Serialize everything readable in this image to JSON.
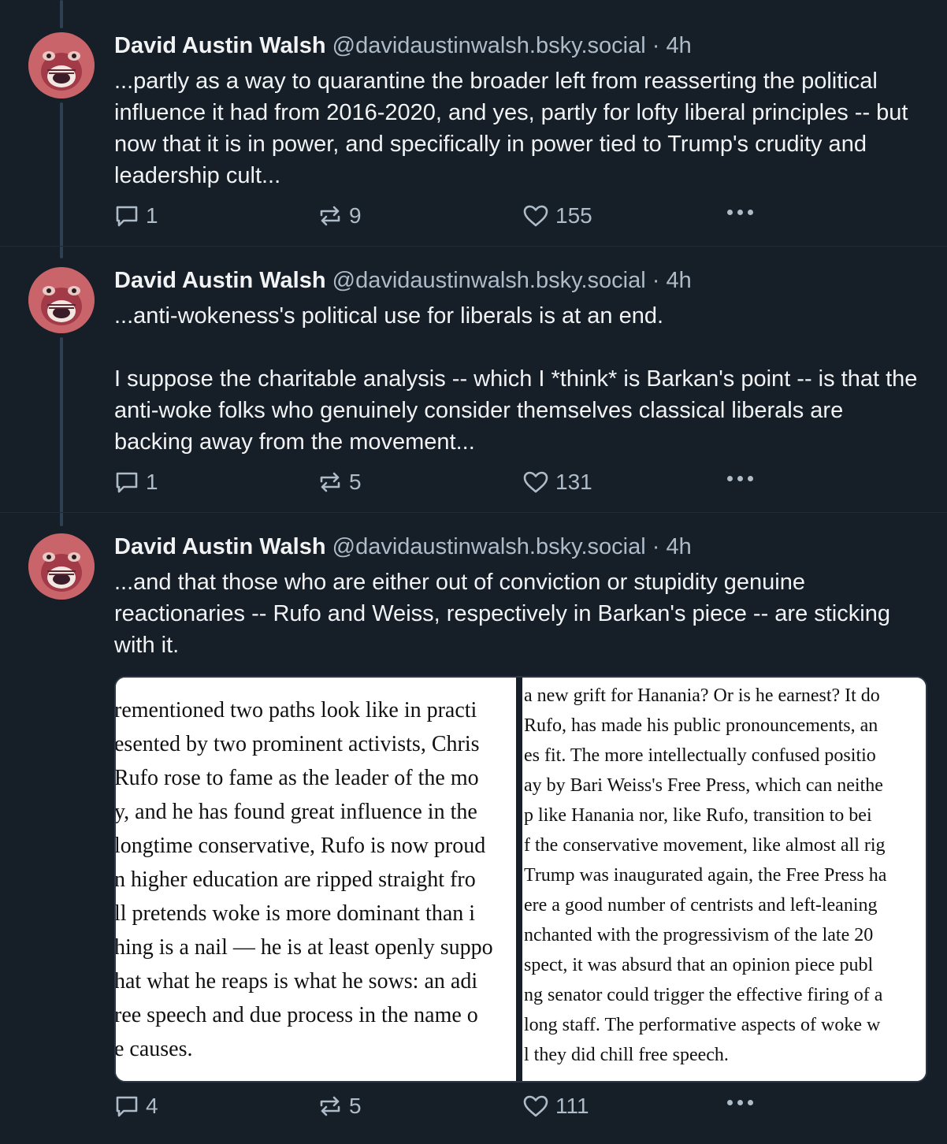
{
  "posts": [
    {
      "author": "David Austin Walsh",
      "handle": "@davidaustinwalsh.bsky.social",
      "separator": "·",
      "time": "4h",
      "text": "...partly as a way to quarantine the broader left from reasserting the political influence it had from 2016-2020, and yes, partly for lofty liberal principles -- but now that it is in power, and specifically in power tied to Trump's crudity and leadership cult...",
      "replies": "1",
      "reposts": "9",
      "likes": "155"
    },
    {
      "author": "David Austin Walsh",
      "handle": "@davidaustinwalsh.bsky.social",
      "separator": "·",
      "time": "4h",
      "text": "...anti-wokeness's political use for liberals is at an end.\n\nI suppose the charitable analysis -- which I *think* is Barkan's point -- is that the anti-woke folks who genuinely consider themselves classical liberals are backing away from the movement...",
      "replies": "1",
      "reposts": "5",
      "likes": "131"
    },
    {
      "author": "David Austin Walsh",
      "handle": "@davidaustinwalsh.bsky.social",
      "separator": "·",
      "time": "4h",
      "text": "...and that those who are either out of conviction or stupidity genuine reactionaries -- Rufo and Weiss, respectively in Barkan's piece -- are sticking with it.",
      "replies": "4",
      "reposts": "5",
      "likes": "111"
    }
  ],
  "images": {
    "left_lines": [
      "rementioned two paths look like in practi",
      "esented by two prominent activists, Chris",
      " Rufo rose to fame as the leader of the mo",
      "y, and he has found great influence in the",
      " longtime conservative, Rufo is now proud",
      "n higher education are ripped straight fro",
      "ll pretends woke is more dominant than i",
      "hing is a nail — he is at least openly suppo",
      "hat what he reaps is what he sows: an adi",
      "ree speech and due process in the name o",
      "e causes."
    ],
    "right_lines": [
      "a new grift for Hanania? Or is he earnest? It do",
      "Rufo, has made his public pronouncements, an",
      "es fit. The more intellectually confused positio",
      "ay by Bari Weiss's Free Press, which can neithe",
      "p like Hanania nor, like Rufo, transition to bei",
      "f the conservative movement, like almost all rig",
      "Trump was inaugurated again, the Free Press ha",
      "ere a good number of centrists and left-leaning",
      "nchanted with the progressivism of the late 20",
      "spect, it was absurd that an opinion piece publ",
      "ng senator could trigger the effective firing of a",
      "long staff. The performative aspects of woke w",
      "l they did chill free speech."
    ]
  },
  "icons": {
    "reply": "reply-icon",
    "repost": "repost-icon",
    "like": "heart-icon",
    "more": "more-options-icon"
  },
  "colors": {
    "background": "#161e27",
    "text": "#f1f3f5",
    "muted": "#aebbc9",
    "thread_line": "#2e4052"
  }
}
